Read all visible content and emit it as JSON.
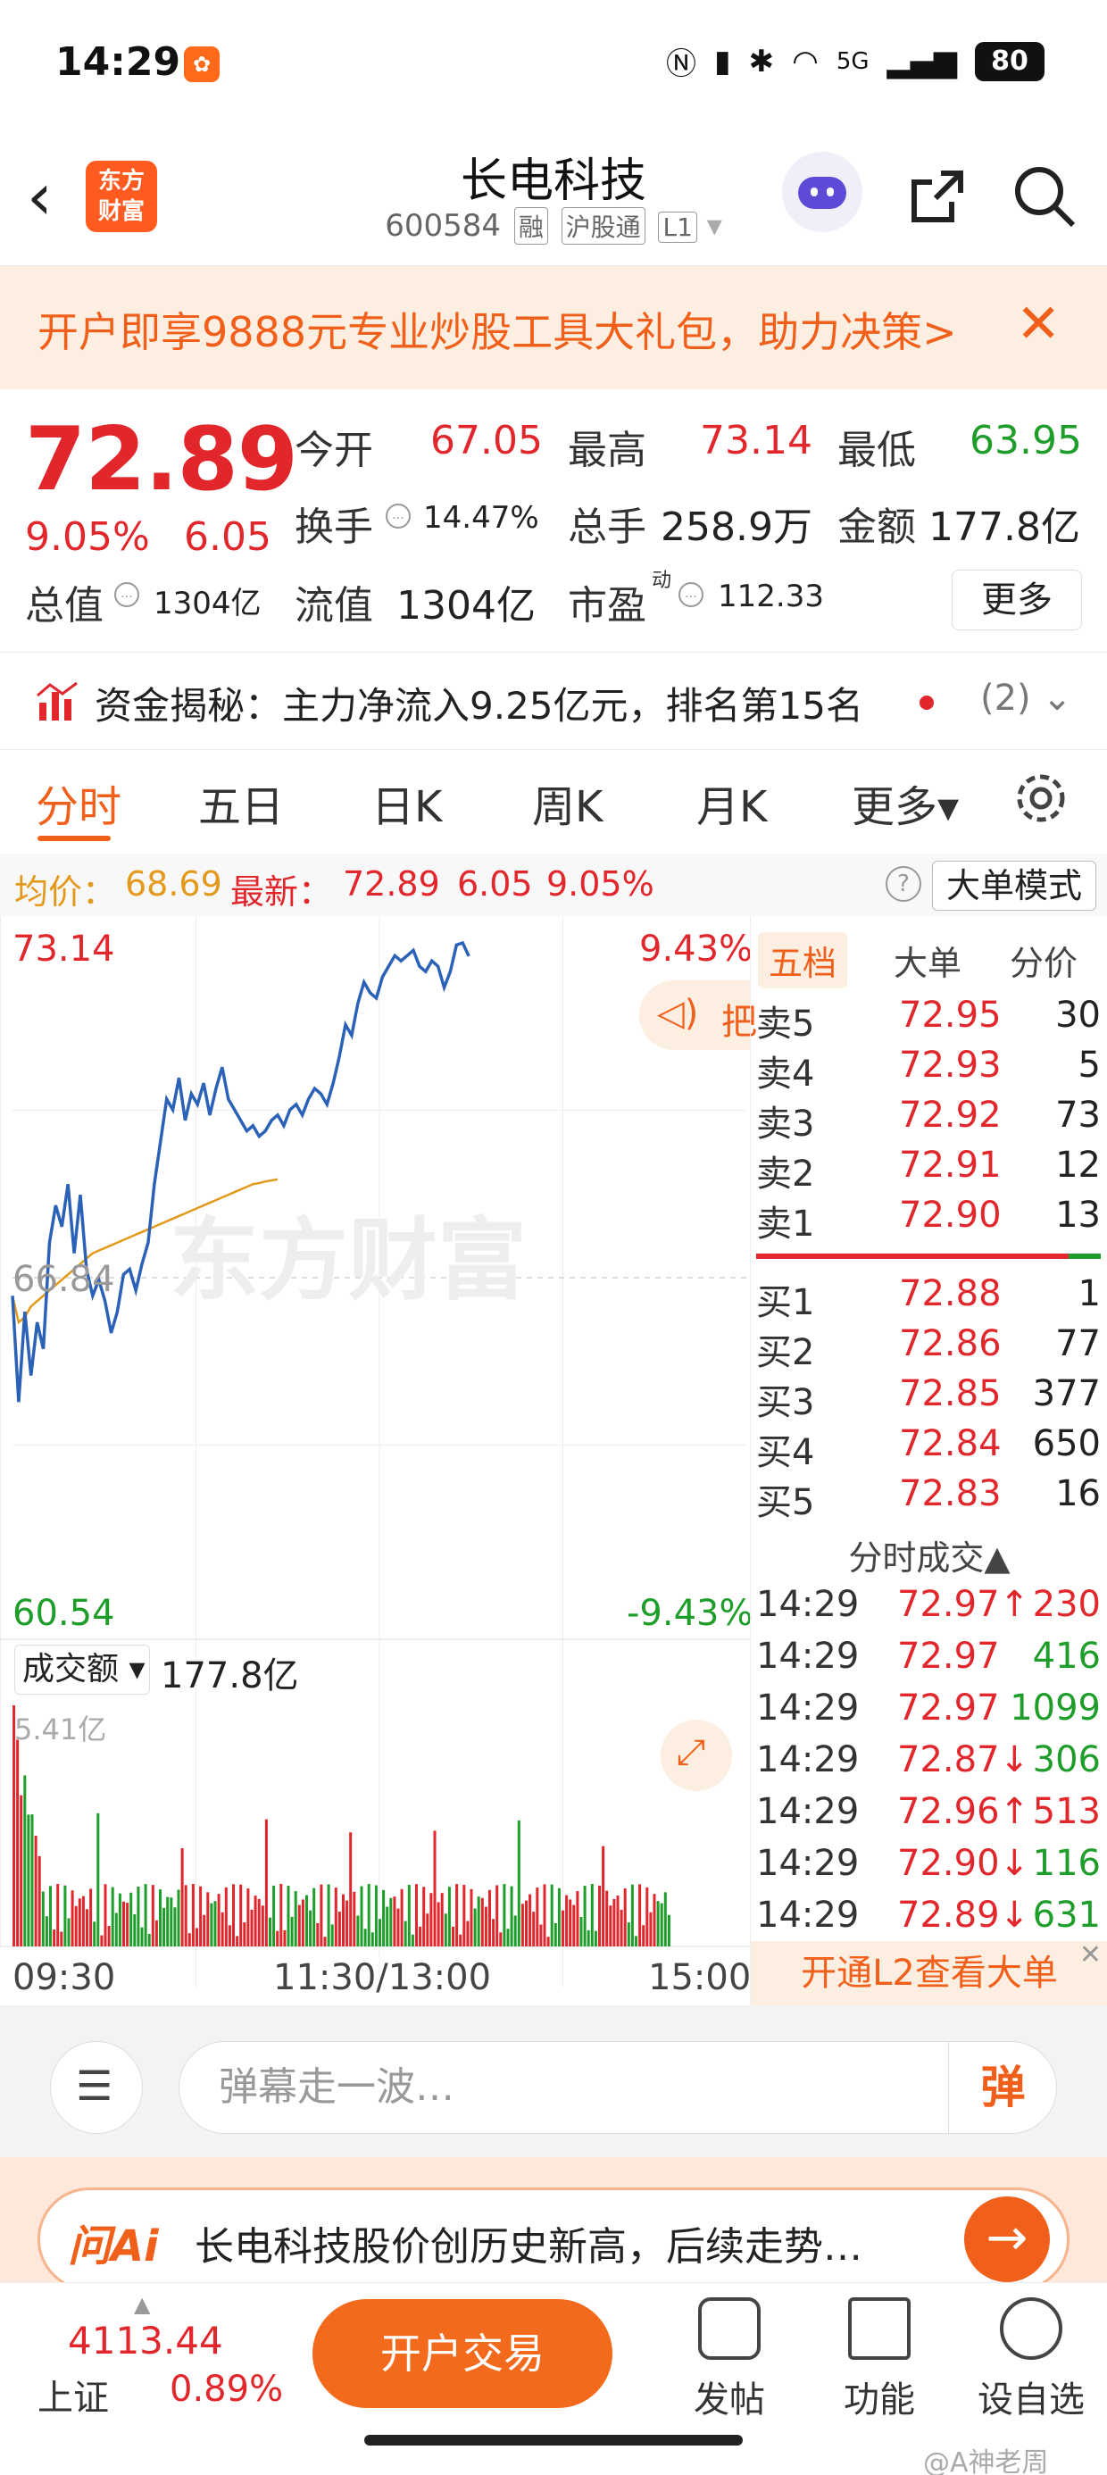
{
  "status_bar": {
    "time": "14:29",
    "battery": "80",
    "network": "5G"
  },
  "header": {
    "back_icon": "chevron-left-icon",
    "app_logo": "东方\n财富",
    "stock_name": "长电科技",
    "stock_code": "600584",
    "tags": [
      "融",
      "沪股通",
      "L1"
    ]
  },
  "promo": {
    "text": "开户即享9888元专业炒股工具大礼包，助力决策>"
  },
  "quote": {
    "price": "72.89",
    "change_pct": "9.05%",
    "change": "6.05",
    "open_label": "今开",
    "open": "67.05",
    "high_label": "最高",
    "high": "73.14",
    "low_label": "最低",
    "low": "63.95",
    "turnover_label": "换手",
    "turnover": "14.47%",
    "volume_label": "总手",
    "volume": "258.9万",
    "amount_label": "金额",
    "amount": "177.8亿",
    "mktcap_label": "总值",
    "mktcap": "1304亿",
    "float_label": "流值",
    "float_cap": "1304亿",
    "pe_label": "市盈",
    "pe_sup": "动",
    "pe": "112.33",
    "more_label": "更多"
  },
  "capital_flow": {
    "text": "资金揭秘：主力净流入9.25亿元，排名第15名",
    "count": "(2)"
  },
  "tabs": [
    {
      "label": "分时",
      "active": true
    },
    {
      "label": "五日",
      "active": false
    },
    {
      "label": "日K",
      "active": false
    },
    {
      "label": "周K",
      "active": false
    },
    {
      "label": "月K",
      "active": false
    },
    {
      "label": "更多▾",
      "active": false
    }
  ],
  "summary": {
    "avg_label": "均价：",
    "avg": "68.69",
    "latest_label": "最新：",
    "latest": "72.89",
    "latest_chg": "6.05",
    "latest_pct": "9.05%",
    "mode_label": "大单模式"
  },
  "chart": {
    "y_top": "73.14",
    "y_mid": "66.84",
    "y_bottom": "60.54",
    "pct_top": "9.43%",
    "pct_bottom": "-9.43%",
    "speaker_text": "把",
    "watermark": "东方财富",
    "volume_label": "成交额 ▾",
    "volume_total": "177.8亿",
    "volume_max": "5.41亿",
    "time_labels": [
      "09:30",
      "11:30/13:00",
      "15:00"
    ],
    "price_color": "#2b62b8",
    "avg_color": "#e39a1c"
  },
  "chart_data": {
    "type": "line",
    "title": "",
    "ylim": [
      60.54,
      73.14
    ],
    "series": [
      {
        "name": "",
        "values": [
          66.5,
          64.5,
          66.2,
          65.0,
          66.0,
          65.5,
          67.5,
          68.2,
          67.8,
          68.6,
          67.3,
          68.4,
          67.0,
          66.5,
          66.8,
          66.4,
          65.8,
          66.2,
          66.9,
          67.0,
          66.6,
          67.1,
          67.5,
          68.6,
          69.4,
          70.2,
          70.0,
          70.6,
          69.8,
          70.3,
          70.1,
          70.5,
          69.9,
          70.4,
          70.8,
          70.2,
          70.0,
          69.8,
          69.6,
          69.7,
          69.5,
          69.6,
          69.8,
          69.9,
          69.7,
          70.0,
          70.1,
          69.9,
          70.2,
          70.4,
          70.3,
          70.1,
          70.5,
          71.0,
          71.6,
          71.4,
          72.0,
          72.4,
          72.2,
          72.1,
          72.5,
          72.7,
          72.9,
          72.8,
          72.9,
          73.0,
          72.7,
          72.6,
          72.8,
          72.7,
          72.3,
          72.6,
          73.1,
          73.14,
          72.89
        ]
      },
      {
        "name": "均价",
        "values": [
          66.5,
          66.0,
          66.1,
          66.3,
          66.4,
          66.5,
          66.6,
          66.7,
          66.8,
          66.9,
          67.0,
          67.1,
          67.2,
          67.3,
          67.35,
          67.4,
          67.45,
          67.5,
          67.55,
          67.6,
          67.65,
          67.7,
          67.75,
          67.8,
          67.85,
          67.9,
          67.95,
          68.0,
          68.05,
          68.1,
          68.15,
          68.2,
          68.25,
          68.3,
          68.35,
          68.4,
          68.45,
          68.5,
          68.55,
          68.6,
          68.62,
          68.65,
          68.67,
          68.69
        ]
      }
    ]
  },
  "order_book": {
    "tabs": [
      "五档",
      "大单",
      "分价"
    ],
    "asks": [
      {
        "label": "卖5",
        "price": "72.95",
        "vol": "30"
      },
      {
        "label": "卖4",
        "price": "72.93",
        "vol": "5"
      },
      {
        "label": "卖3",
        "price": "72.92",
        "vol": "73"
      },
      {
        "label": "卖2",
        "price": "72.91",
        "vol": "12"
      },
      {
        "label": "卖1",
        "price": "72.90",
        "vol": "13"
      }
    ],
    "bids": [
      {
        "label": "买1",
        "price": "72.88",
        "vol": "1"
      },
      {
        "label": "买2",
        "price": "72.86",
        "vol": "77"
      },
      {
        "label": "买3",
        "price": "72.85",
        "vol": "377"
      },
      {
        "label": "买4",
        "price": "72.84",
        "vol": "650"
      },
      {
        "label": "买5",
        "price": "72.83",
        "vol": "16"
      }
    ],
    "trades_title": "分时成交▲",
    "trades": [
      {
        "time": "14:29",
        "price": "72.97↑",
        "vol": "230",
        "dir": "up"
      },
      {
        "time": "14:29",
        "price": "72.97",
        "vol": "416",
        "dir": "none"
      },
      {
        "time": "14:29",
        "price": "72.97",
        "vol": "1099",
        "dir": "none"
      },
      {
        "time": "14:29",
        "price": "72.87↓",
        "vol": "306",
        "dir": "down"
      },
      {
        "time": "14:29",
        "price": "72.96↑",
        "vol": "513",
        "dir": "up"
      },
      {
        "time": "14:29",
        "price": "72.90↓",
        "vol": "116",
        "dir": "down"
      },
      {
        "time": "14:29",
        "price": "72.89↓",
        "vol": "631",
        "dir": "down"
      }
    ],
    "l2_label": "开通L2查看大单"
  },
  "comment": {
    "placeholder": "弹幕走一波…",
    "danmu_btn": "弹"
  },
  "ai_bar": {
    "logo": "问Ai",
    "text": "长电科技股价创历史新高，后续走势…"
  },
  "nav": {
    "index_value": "4113.44",
    "index_name": "上证",
    "index_pct": "0.89%",
    "trade_btn": "开户交易",
    "items": [
      "发帖",
      "功能",
      "设自选"
    ],
    "watermark": "@A神老周"
  }
}
